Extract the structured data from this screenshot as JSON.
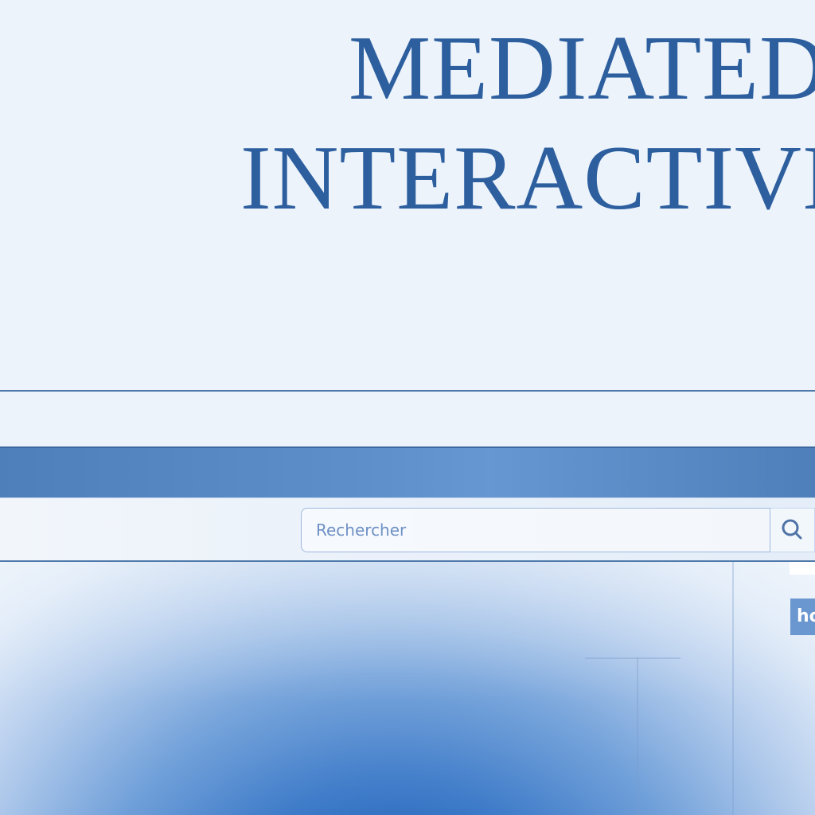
{
  "header": {
    "title_line_1": "MEDIATED",
    "title_line_2": "INTERACTIVIT"
  },
  "search": {
    "placeholder": "Rechercher"
  },
  "icons": {
    "search": "search-icon"
  },
  "hero": {
    "tab_label": "ho"
  },
  "colors": {
    "title": "#2d5f9f",
    "nav": "#4f7fba",
    "border": "#4f79aa",
    "hero_accent": "#3f7cc9"
  }
}
